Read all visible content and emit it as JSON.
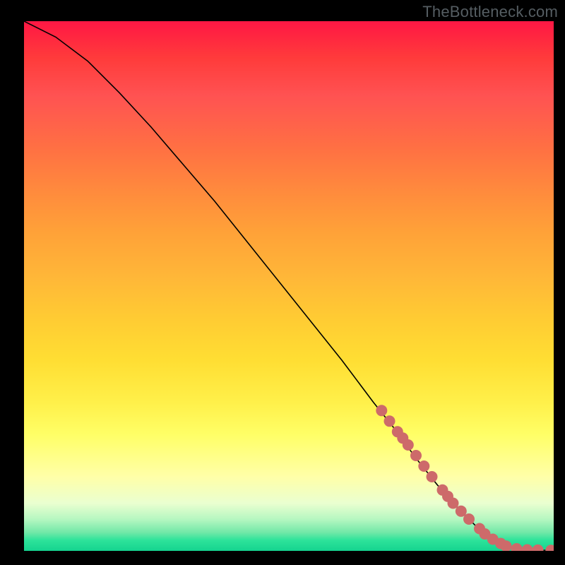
{
  "watermark": "TheBottleneck.com",
  "background_colors": {
    "frame": "#000000",
    "gradient_top": "#ff1744",
    "gradient_mid": "#ffde33",
    "gradient_bottom": "#15d38f"
  },
  "chart_data": {
    "type": "line",
    "title": "",
    "xlabel": "",
    "ylabel": "",
    "xlim": [
      0,
      100
    ],
    "ylim": [
      0,
      100
    ],
    "series": [
      {
        "name": "curve",
        "x": [
          0,
          6,
          12,
          18,
          24,
          30,
          36,
          42,
          48,
          54,
          60,
          66,
          70,
          74,
          78,
          82,
          86,
          88,
          90,
          92,
          94,
          96,
          98,
          100
        ],
        "y": [
          100,
          97,
          92.5,
          86.5,
          80,
          73,
          66,
          58.5,
          51,
          43.5,
          36,
          28,
          23,
          17.5,
          12.5,
          8,
          4,
          2.4,
          1.3,
          0.7,
          0.35,
          0.2,
          0.12,
          0.1
        ]
      }
    ],
    "highlighted_points": {
      "name": "markers",
      "color": "#cd6a6a",
      "x": [
        67.5,
        69,
        70.5,
        71.5,
        72.5,
        74,
        75.5,
        77,
        79,
        80,
        81,
        82.5,
        84,
        86,
        87,
        88.5,
        90,
        91,
        93,
        95,
        97,
        99.5
      ],
      "y": [
        26.5,
        24.5,
        22.5,
        21.3,
        20,
        18,
        16,
        14,
        11.5,
        10.3,
        9,
        7.5,
        6,
        4.2,
        3.2,
        2.2,
        1.4,
        0.9,
        0.4,
        0.2,
        0.15,
        0.1
      ]
    }
  }
}
